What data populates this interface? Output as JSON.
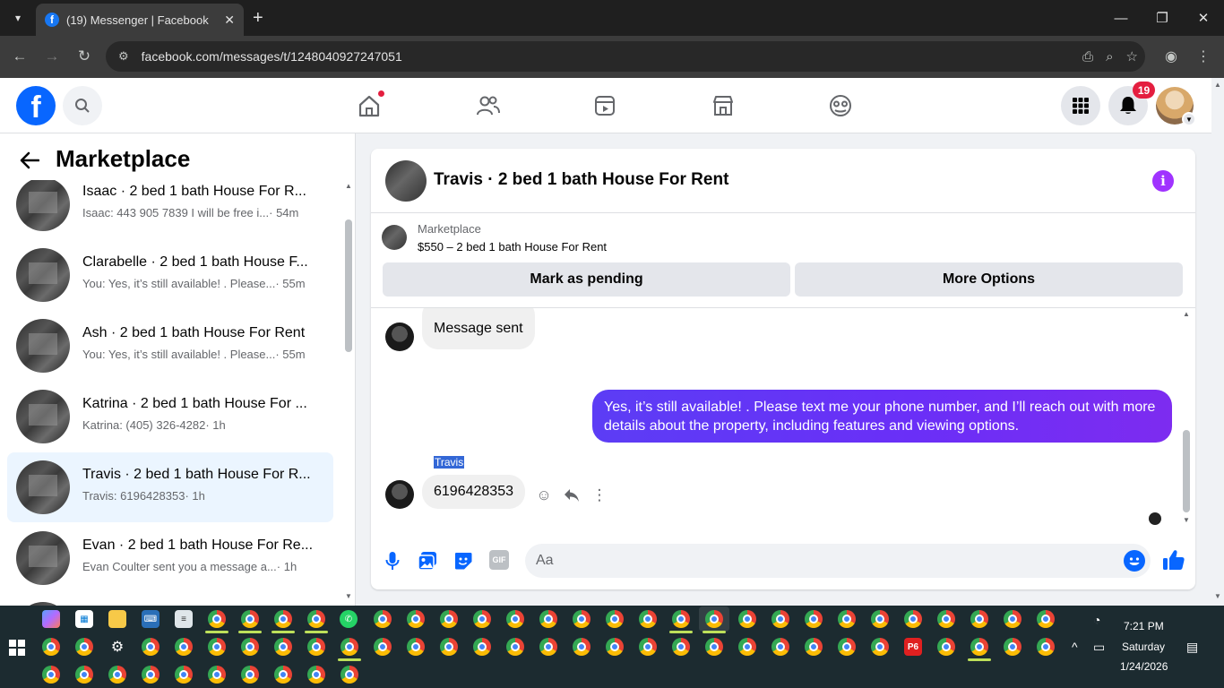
{
  "browser": {
    "tab_title": "(19) Messenger | Facebook",
    "tab_favicon": "f",
    "url": "facebook.com/messages/t/1248040927247051",
    "close_tab": "✕",
    "new_tab": "+",
    "win_minimize": "—",
    "win_restore": "❐",
    "win_close": "✕"
  },
  "fb": {
    "logo_letter": "f",
    "notification_count": "19"
  },
  "left": {
    "title": "Marketplace",
    "conversations": [
      {
        "name": "Isaac · 2 bed 1 bath House For R...",
        "preview": "Isaac: 443 905 7839 I will be free i...",
        "time": " · 54m"
      },
      {
        "name": "Clarabelle · 2 bed 1 bath House F...",
        "preview": "You: Yes, it’s still available! . Please...",
        "time": " · 55m"
      },
      {
        "name": "Ash · 2 bed 1 bath House For Rent",
        "preview": "You: Yes, it’s still available! . Please...",
        "time": " · 55m"
      },
      {
        "name": "Katrina · 2 bed 1 bath House For ...",
        "preview": "Katrina: (405) 326-4282",
        "time": " · 1h"
      },
      {
        "name": "Travis · 2 bed 1 bath House For R...",
        "preview": "Travis: 6196428353",
        "time": " · 1h"
      },
      {
        "name": "Evan · 2 bed 1 bath House For Re...",
        "preview": "Evan Coulter sent you a message a...",
        "time": " · 1h"
      }
    ]
  },
  "chat": {
    "title": "Travis · 2 bed 1 bath House For Rent",
    "marketplace_label": "Marketplace",
    "listing": "$550 – 2 bed 1 bath House For Rent",
    "mark_pending": "Mark as pending",
    "more_options": "More Options",
    "messages": {
      "sent_notice": "Message sent",
      "outgoing": "Yes, it’s still available! . Please text me your phone number, and I’ll reach out with more details about the property, including features and viewing options.",
      "sender_name": "Travis",
      "incoming": "6196428353"
    },
    "composer_placeholder": "Aa"
  },
  "taskbar": {
    "time": "7:21 PM",
    "day": "Saturday",
    "date": "1/24/2026",
    "p6_label": "P6"
  },
  "colors": {
    "fb_blue": "#0866ff",
    "bubble_gradient_start": "#5c3df5",
    "bubble_gradient_end": "#7d2cf0",
    "badge_red": "#e41e3f",
    "info_purple": "#a033ff"
  }
}
